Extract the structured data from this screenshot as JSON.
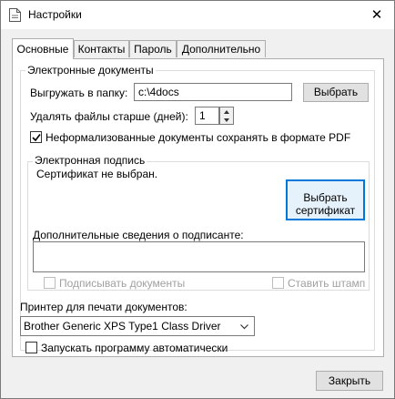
{
  "window": {
    "title": "Настройки"
  },
  "tabs": [
    {
      "label": "Основные"
    },
    {
      "label": "Контакты"
    },
    {
      "label": "Пароль"
    },
    {
      "label": "Дополнительно"
    }
  ],
  "edocs": {
    "group_title": "Электронные документы",
    "export_label": "Выгружать в папку:",
    "export_path": "c:\\4docs",
    "browse_button": "Выбрать",
    "delete_label": "Удалять файлы старше (дней):",
    "delete_days": "1",
    "pdf_checkbox_label": "Неформализованные документы сохранять в формате PDF",
    "pdf_checked": true
  },
  "esign": {
    "group_title": "Электронная подпись",
    "cert_status": "Сертификат не выбран.",
    "select_cert_line1": "Выбрать",
    "select_cert_line2": "сертификат",
    "signer_info_label": "Дополнительные сведения о подписанте:",
    "signer_info_value": "",
    "sign_docs_label": "Подписывать документы",
    "stamp_label": "Ставить штамп"
  },
  "printer": {
    "label": "Принтер для печати документов:",
    "selected": "Brother Generic XPS Type1 Class Driver"
  },
  "autostart": {
    "label": "Запускать программу автоматически",
    "checked": false
  },
  "footer": {
    "close_button": "Закрыть"
  }
}
